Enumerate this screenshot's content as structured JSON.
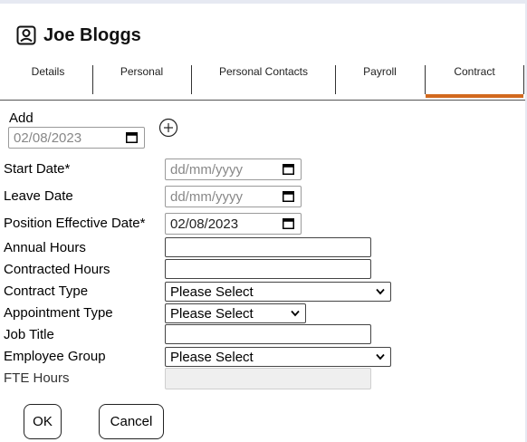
{
  "header": {
    "name": "Joe Bloggs",
    "icon": "user-portrait-icon"
  },
  "tabs": [
    {
      "label": "Details"
    },
    {
      "label": "Personal"
    },
    {
      "label": "Personal Contacts"
    },
    {
      "label": "Payroll"
    },
    {
      "label": "Contract",
      "active": true
    }
  ],
  "accent_color": "#d2691e",
  "add": {
    "label": "Add",
    "date_value": "02/08/2023"
  },
  "fields": {
    "start_date": {
      "label": "Start Date*",
      "value": "dd/mm/yyyy"
    },
    "leave_date": {
      "label": "Leave Date",
      "value": "dd/mm/yyyy"
    },
    "position_effective_date": {
      "label": "Position Effective Date*",
      "value": "02/08/2023"
    },
    "annual_hours": {
      "label": "Annual Hours",
      "value": ""
    },
    "contracted_hours": {
      "label": "Contracted Hours",
      "value": ""
    },
    "contract_type": {
      "label": "Contract Type",
      "value": "Please Select"
    },
    "appointment_type": {
      "label": "Appointment Type",
      "value": "Please Select"
    },
    "job_title": {
      "label": "Job Title",
      "value": ""
    },
    "employee_group": {
      "label": "Employee Group",
      "value": "Please Select"
    },
    "fte_hours": {
      "label": "FTE Hours",
      "value": ""
    }
  },
  "buttons": {
    "ok": "OK",
    "cancel": "Cancel"
  }
}
